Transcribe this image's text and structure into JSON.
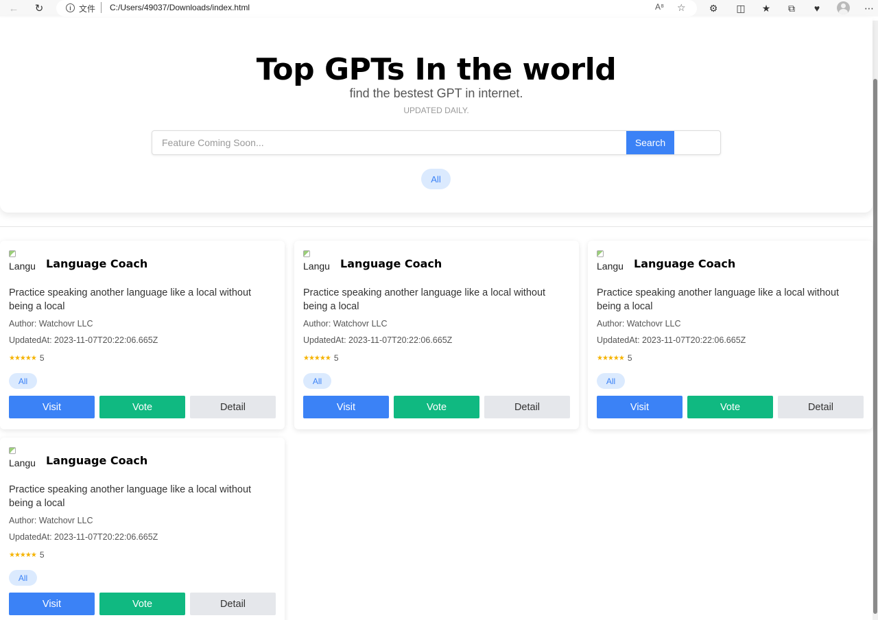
{
  "browser": {
    "address_scheme_label": "文件",
    "url": "C:/Users/49037/Downloads/index.html"
  },
  "hero": {
    "title": "Top GPTs In the world",
    "subtitle": "find the bestest GPT in internet.",
    "updated": "UPDATED DAILY.",
    "search_placeholder": "Feature Coming Soon...",
    "search_button": "Search",
    "category_chip": "All"
  },
  "cards": [
    {
      "image_alt": "Langu",
      "title": "Language Coach",
      "description": "Practice speaking another language like a local without being a local",
      "author": "Author: Watchovr LLC",
      "updated_at": "UpdatedAt: 2023-11-07T20:22:06.665Z",
      "stars": "★★★★★",
      "rating": "5",
      "category": "All",
      "visit_label": "Visit",
      "vote_label": "Vote",
      "detail_label": "Detail"
    },
    {
      "image_alt": "Langu",
      "title": "Language Coach",
      "description": "Practice speaking another language like a local without being a local",
      "author": "Author: Watchovr LLC",
      "updated_at": "UpdatedAt: 2023-11-07T20:22:06.665Z",
      "stars": "★★★★★",
      "rating": "5",
      "category": "All",
      "visit_label": "Visit",
      "vote_label": "Vote",
      "detail_label": "Detail"
    },
    {
      "image_alt": "Langu",
      "title": "Language Coach",
      "description": "Practice speaking another language like a local without being a local",
      "author": "Author: Watchovr LLC",
      "updated_at": "UpdatedAt: 2023-11-07T20:22:06.665Z",
      "stars": "★★★★★",
      "rating": "5",
      "category": "All",
      "visit_label": "Visit",
      "vote_label": "Vote",
      "detail_label": "Detail"
    },
    {
      "image_alt": "Langu",
      "title": "Language Coach",
      "description": "Practice speaking another language like a local without being a local",
      "author": "Author: Watchovr LLC",
      "updated_at": "UpdatedAt: 2023-11-07T20:22:06.665Z",
      "stars": "★★★★★",
      "rating": "5",
      "category": "All",
      "visit_label": "Visit",
      "vote_label": "Vote",
      "detail_label": "Detail"
    }
  ],
  "colors": {
    "primary_blue": "#3b82f6",
    "vote_green": "#10b981",
    "detail_gray": "#e5e7eb",
    "chip_bg": "#dbeafe",
    "star": "#f5b301"
  }
}
